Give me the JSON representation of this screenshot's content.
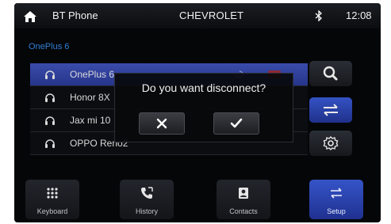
{
  "topbar": {
    "title": "BT Phone",
    "brand": "CHEVROLET",
    "time": "12:08"
  },
  "device": {
    "name": "OnePlus 6"
  },
  "devices": [
    {
      "name": "OnePlus 6",
      "selected": true
    },
    {
      "name": "Honor 8X",
      "selected": false
    },
    {
      "name": "Jax mi 10",
      "selected": false
    },
    {
      "name": "OPPO Reno2",
      "selected": false
    }
  ],
  "dialog": {
    "message": "Do you want disconnect?"
  },
  "side_buttons": [
    {
      "icon": "search-icon",
      "active": false
    },
    {
      "icon": "transfer-arrows-icon",
      "active": true
    },
    {
      "icon": "gear-icon",
      "active": false
    }
  ],
  "nav": [
    {
      "label": "Keyboard",
      "icon": "keypad-icon",
      "active": false
    },
    {
      "label": "History",
      "icon": "call-history-icon",
      "active": false
    },
    {
      "label": "Contacts",
      "icon": "contacts-icon",
      "active": false
    },
    {
      "label": "Setup",
      "icon": "transfer-arrows-icon",
      "active": true
    }
  ],
  "colors": {
    "accent": "#2f7fd6",
    "selected": "#3a4cab",
    "active_button": "#3552c4",
    "background": "#050608"
  }
}
